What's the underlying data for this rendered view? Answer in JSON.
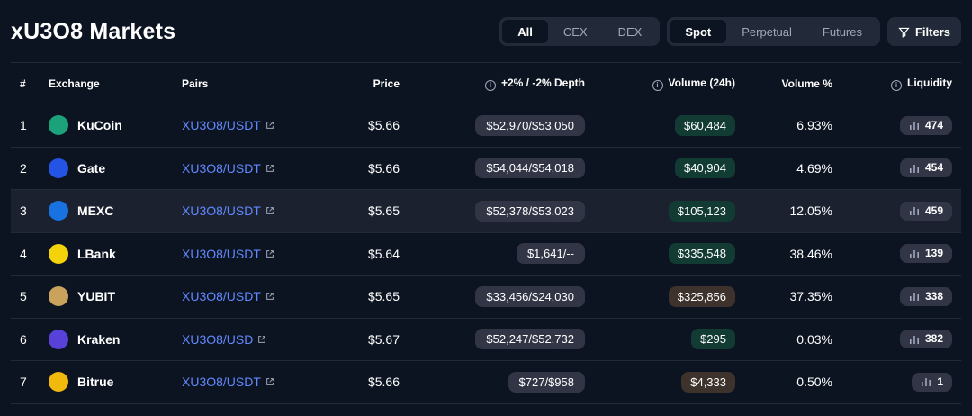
{
  "page": {
    "title": "xU3O8 Markets"
  },
  "filters": {
    "exchange_type": [
      "All",
      "CEX",
      "DEX"
    ],
    "exchange_type_selected": "All",
    "market_type": [
      "Spot",
      "Perpetual",
      "Futures"
    ],
    "market_type_selected": "Spot",
    "filters_label": "Filters"
  },
  "table": {
    "headers": {
      "rank": "#",
      "exchange": "Exchange",
      "pairs": "Pairs",
      "price": "Price",
      "depth": "+2% / -2% Depth",
      "volume": "Volume (24h)",
      "volume_pct": "Volume %",
      "liquidity": "Liquidity"
    },
    "rows": [
      {
        "rank": "1",
        "exchange": "KuCoin",
        "logo_color": "#1ba27a",
        "pair": "XU3O8/USDT",
        "price": "$5.66",
        "depth": "$52,970/$53,050",
        "volume": "$60,484",
        "volume_bg": "#123b33",
        "volume_pct": "6.93%",
        "liquidity": "474"
      },
      {
        "rank": "2",
        "exchange": "Gate",
        "logo_color": "#2354e6",
        "pair": "XU3O8/USDT",
        "price": "$5.66",
        "depth": "$54,044/$54,018",
        "volume": "$40,904",
        "volume_bg": "#123b33",
        "volume_pct": "4.69%",
        "liquidity": "454"
      },
      {
        "rank": "3",
        "exchange": "MEXC",
        "logo_color": "#1972e2",
        "pair": "XU3O8/USDT",
        "price": "$5.65",
        "depth": "$52,378/$53,023",
        "volume": "$105,123",
        "volume_bg": "#123b33",
        "volume_pct": "12.05%",
        "liquidity": "459"
      },
      {
        "rank": "4",
        "exchange": "LBank",
        "logo_color": "#f5d30b",
        "pair": "XU3O8/USDT",
        "price": "$5.64",
        "depth": "$1,641/--",
        "volume": "$335,548",
        "volume_bg": "#123b33",
        "volume_pct": "38.46%",
        "liquidity": "139"
      },
      {
        "rank": "5",
        "exchange": "YUBIT",
        "logo_color": "#c9a35b",
        "pair": "XU3O8/USDT",
        "price": "$5.65",
        "depth": "$33,456/$24,030",
        "volume": "$325,856",
        "volume_bg": "#3d322c",
        "volume_pct": "37.35%",
        "liquidity": "338"
      },
      {
        "rank": "6",
        "exchange": "Kraken",
        "logo_color": "#5741d9",
        "pair": "XU3O8/USD",
        "price": "$5.67",
        "depth": "$52,247/$52,732",
        "volume": "$295",
        "volume_bg": "#123b33",
        "volume_pct": "0.03%",
        "liquidity": "382"
      },
      {
        "rank": "7",
        "exchange": "Bitrue",
        "logo_color": "#f0b90b",
        "pair": "XU3O8/USDT",
        "price": "$5.66",
        "depth": "$727/$958",
        "volume": "$4,333",
        "volume_bg": "#3d322c",
        "volume_pct": "0.50%",
        "liquidity": "1"
      }
    ],
    "highlighted_row": "3"
  }
}
